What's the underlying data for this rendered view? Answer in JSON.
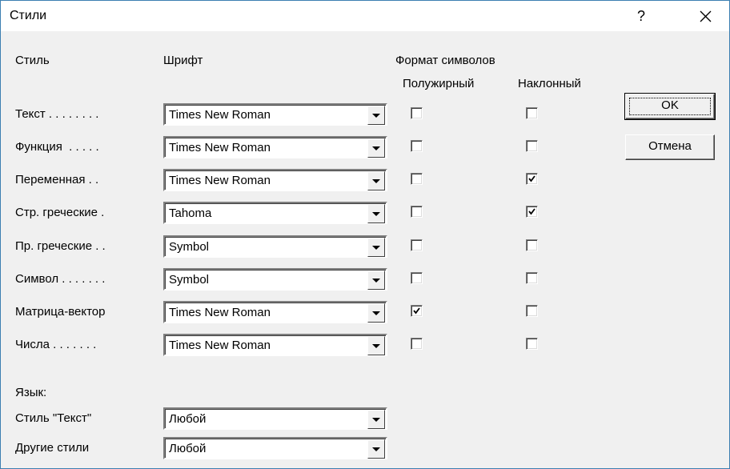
{
  "window": {
    "title": "Стили",
    "help_label": "?",
    "close_icon": "close-icon"
  },
  "headers": {
    "style": "Стиль",
    "font": "Шрифт",
    "char_format": "Формат символов",
    "bold": "Полужирный",
    "italic": "Наклонный"
  },
  "styles": [
    {
      "label": "Текст . . . . . . . .",
      "font": "Times New Roman",
      "bold": false,
      "italic": false
    },
    {
      "label": "Функция  . . . . .",
      "font": "Times New Roman",
      "bold": false,
      "italic": false
    },
    {
      "label": "Переменная . .",
      "font": "Times New Roman",
      "bold": false,
      "italic": true
    },
    {
      "label": "Стр. греческие .",
      "font": "Tahoma",
      "bold": false,
      "italic": true
    },
    {
      "label": "Пр. греческие . .",
      "font": "Symbol",
      "bold": false,
      "italic": false
    },
    {
      "label": "Символ . . . . . . .",
      "font": "Symbol",
      "bold": false,
      "italic": false
    },
    {
      "label": "Матрица-вектор",
      "font": "Times New Roman",
      "bold": true,
      "italic": false
    },
    {
      "label": "Числа . . . . . . .",
      "font": "Times New Roman",
      "bold": false,
      "italic": false
    }
  ],
  "language": {
    "heading": "Язык:",
    "rows": [
      {
        "label": "Стиль \"Текст\"",
        "value": "Любой"
      },
      {
        "label": "Другие стили",
        "value": "Любой"
      }
    ]
  },
  "buttons": {
    "ok": "OK",
    "cancel": "Отмена"
  }
}
